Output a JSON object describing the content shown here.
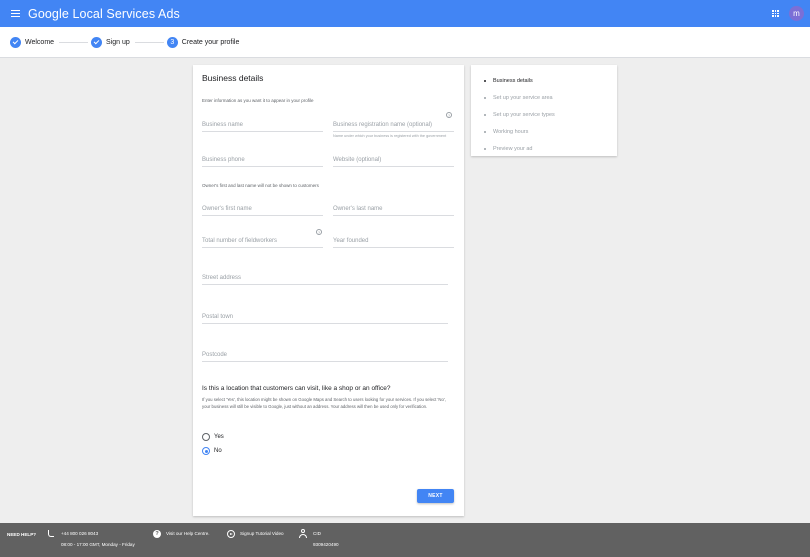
{
  "header": {
    "app_title": "Google Local Services Ads",
    "avatar_letter": "m"
  },
  "stepper": {
    "steps": [
      {
        "label": "Welcome",
        "state": "done"
      },
      {
        "label": "Sign up",
        "state": "done"
      },
      {
        "label": "Create your profile",
        "number": "3",
        "state": "current"
      }
    ]
  },
  "form": {
    "title": "Business details",
    "intro": "Enter information as you want it to appear in your profile",
    "business_name": {
      "placeholder": "Business name"
    },
    "registration_name": {
      "placeholder": "Business registration name (optional)",
      "hint": "Name under which your business is registered with the government"
    },
    "business_phone": {
      "placeholder": "Business phone"
    },
    "website": {
      "placeholder": "Website (optional)"
    },
    "owner_note": "Owner's first and last name will not be shown to customers",
    "owner_first": {
      "placeholder": "Owner's first name"
    },
    "owner_last": {
      "placeholder": "Owner's last name"
    },
    "fieldworkers": {
      "placeholder": "Total number of fieldworkers"
    },
    "year_founded": {
      "placeholder": "Year founded"
    },
    "street": {
      "placeholder": "Street address"
    },
    "town": {
      "placeholder": "Postal town"
    },
    "postcode": {
      "placeholder": "Postcode"
    },
    "question": "Is this a location that customers can visit, like a shop or an office?",
    "question_help": "If you select 'Yes', this location might be shown on Google Maps and Search to users looking for your services. If you select 'No', your business will still be visible to Google, just without an address. Your address will then be used only for verification.",
    "options": {
      "yes": "Yes",
      "no": "No"
    },
    "selected": "No",
    "next_label": "NEXT"
  },
  "sidenav": {
    "items": [
      {
        "label": "Business details",
        "active": true
      },
      {
        "label": "Set up your service area",
        "active": false
      },
      {
        "label": "Set up your service types",
        "active": false
      },
      {
        "label": "Working hours",
        "active": false
      },
      {
        "label": "Preview your ad",
        "active": false
      }
    ]
  },
  "footer": {
    "need_help": "NEED HELP?",
    "phone": "+44 800 026 8043",
    "hours": "08:00 - 17:00 GMT, Monday - Friday",
    "help_centre": "Visit our Help Centre.",
    "tutorial": "Signup Tutorial Video",
    "cid_label": "CID",
    "cid_value": "9309420490"
  },
  "colors": {
    "primary": "#4285f4",
    "footer_bg": "#616161",
    "avatar": "#7b6fd6"
  }
}
